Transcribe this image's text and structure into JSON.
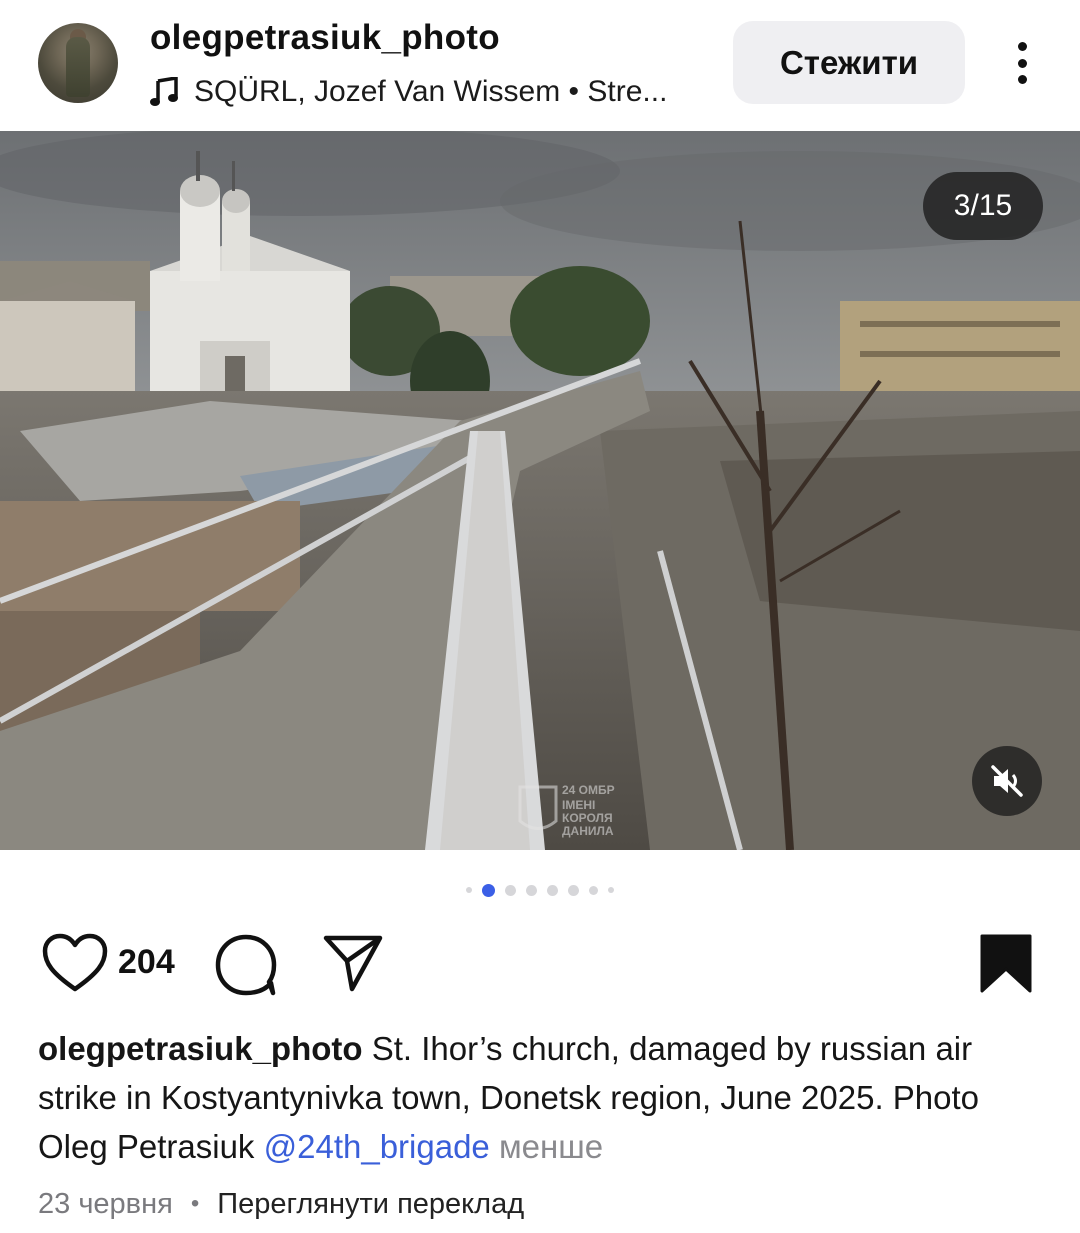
{
  "post": {
    "username": "olegpetrasiuk_photo",
    "music": "SQÜRL, Jozef Van Wissem • Stre...",
    "follow_label": "Стежити",
    "counter": "3/15",
    "likes": "204",
    "caption": {
      "username": "olegpetrasiuk_photo",
      "text": "St. Ihor’s church, damaged by russian air strike in Kostyantynivka town, Donetsk region, June 2025. Photo Oleg Petrasiuk",
      "mention": "@24th_brigade",
      "less_label": "менше"
    },
    "date": "23 червня",
    "separator": "•",
    "translate_label": "Переглянути переклад",
    "watermark": "24 ОМБР ІМЕНІ КОРОЛЯ ДАНИЛА"
  },
  "carousel": {
    "total_dots": 8,
    "active_index": 1
  },
  "colors": {
    "accent": "#3a5fd9",
    "button_bg": "#efeff2",
    "muted": "#8a8a8e"
  },
  "icons": [
    "music-note-icon",
    "more-icon",
    "heart-icon",
    "comment-icon",
    "share-icon",
    "bookmark-icon",
    "speaker-muted-icon"
  ]
}
